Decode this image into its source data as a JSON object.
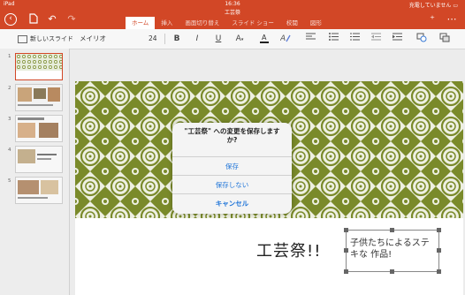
{
  "status": {
    "device": "iPad",
    "time": "16:36",
    "charge": "充電していません"
  },
  "document": {
    "title": "工芸祭"
  },
  "tabs": [
    {
      "label": "ホーム",
      "active": true
    },
    {
      "label": "挿入",
      "active": false
    },
    {
      "label": "画面切り替え",
      "active": false
    },
    {
      "label": "スライド ショー",
      "active": false
    },
    {
      "label": "校閲",
      "active": false
    },
    {
      "label": "図形",
      "active": false
    }
  ],
  "ribbon": {
    "new_slide": "新しいスライド",
    "font_name": "メイリオ",
    "font_size": "24",
    "bold": "B",
    "italic": "I",
    "underline": "U",
    "font_size_change": "A"
  },
  "slides": [
    {
      "number": "1",
      "selected": true
    },
    {
      "number": "2",
      "selected": false
    },
    {
      "number": "3",
      "selected": false
    },
    {
      "number": "4",
      "selected": false
    },
    {
      "number": "5",
      "selected": false
    }
  ],
  "slide": {
    "title": "工芸祭!!",
    "textbox": "子供たちによるステキな 作品!"
  },
  "dialog": {
    "message": "\"工芸祭\" への変更を保存しますか?",
    "save": "保存",
    "dont_save": "保存しない",
    "cancel": "キャンセル"
  },
  "colors": {
    "accent": "#d24726",
    "pattern_green": "#7a8a2a",
    "link_blue": "#1e74d8"
  }
}
